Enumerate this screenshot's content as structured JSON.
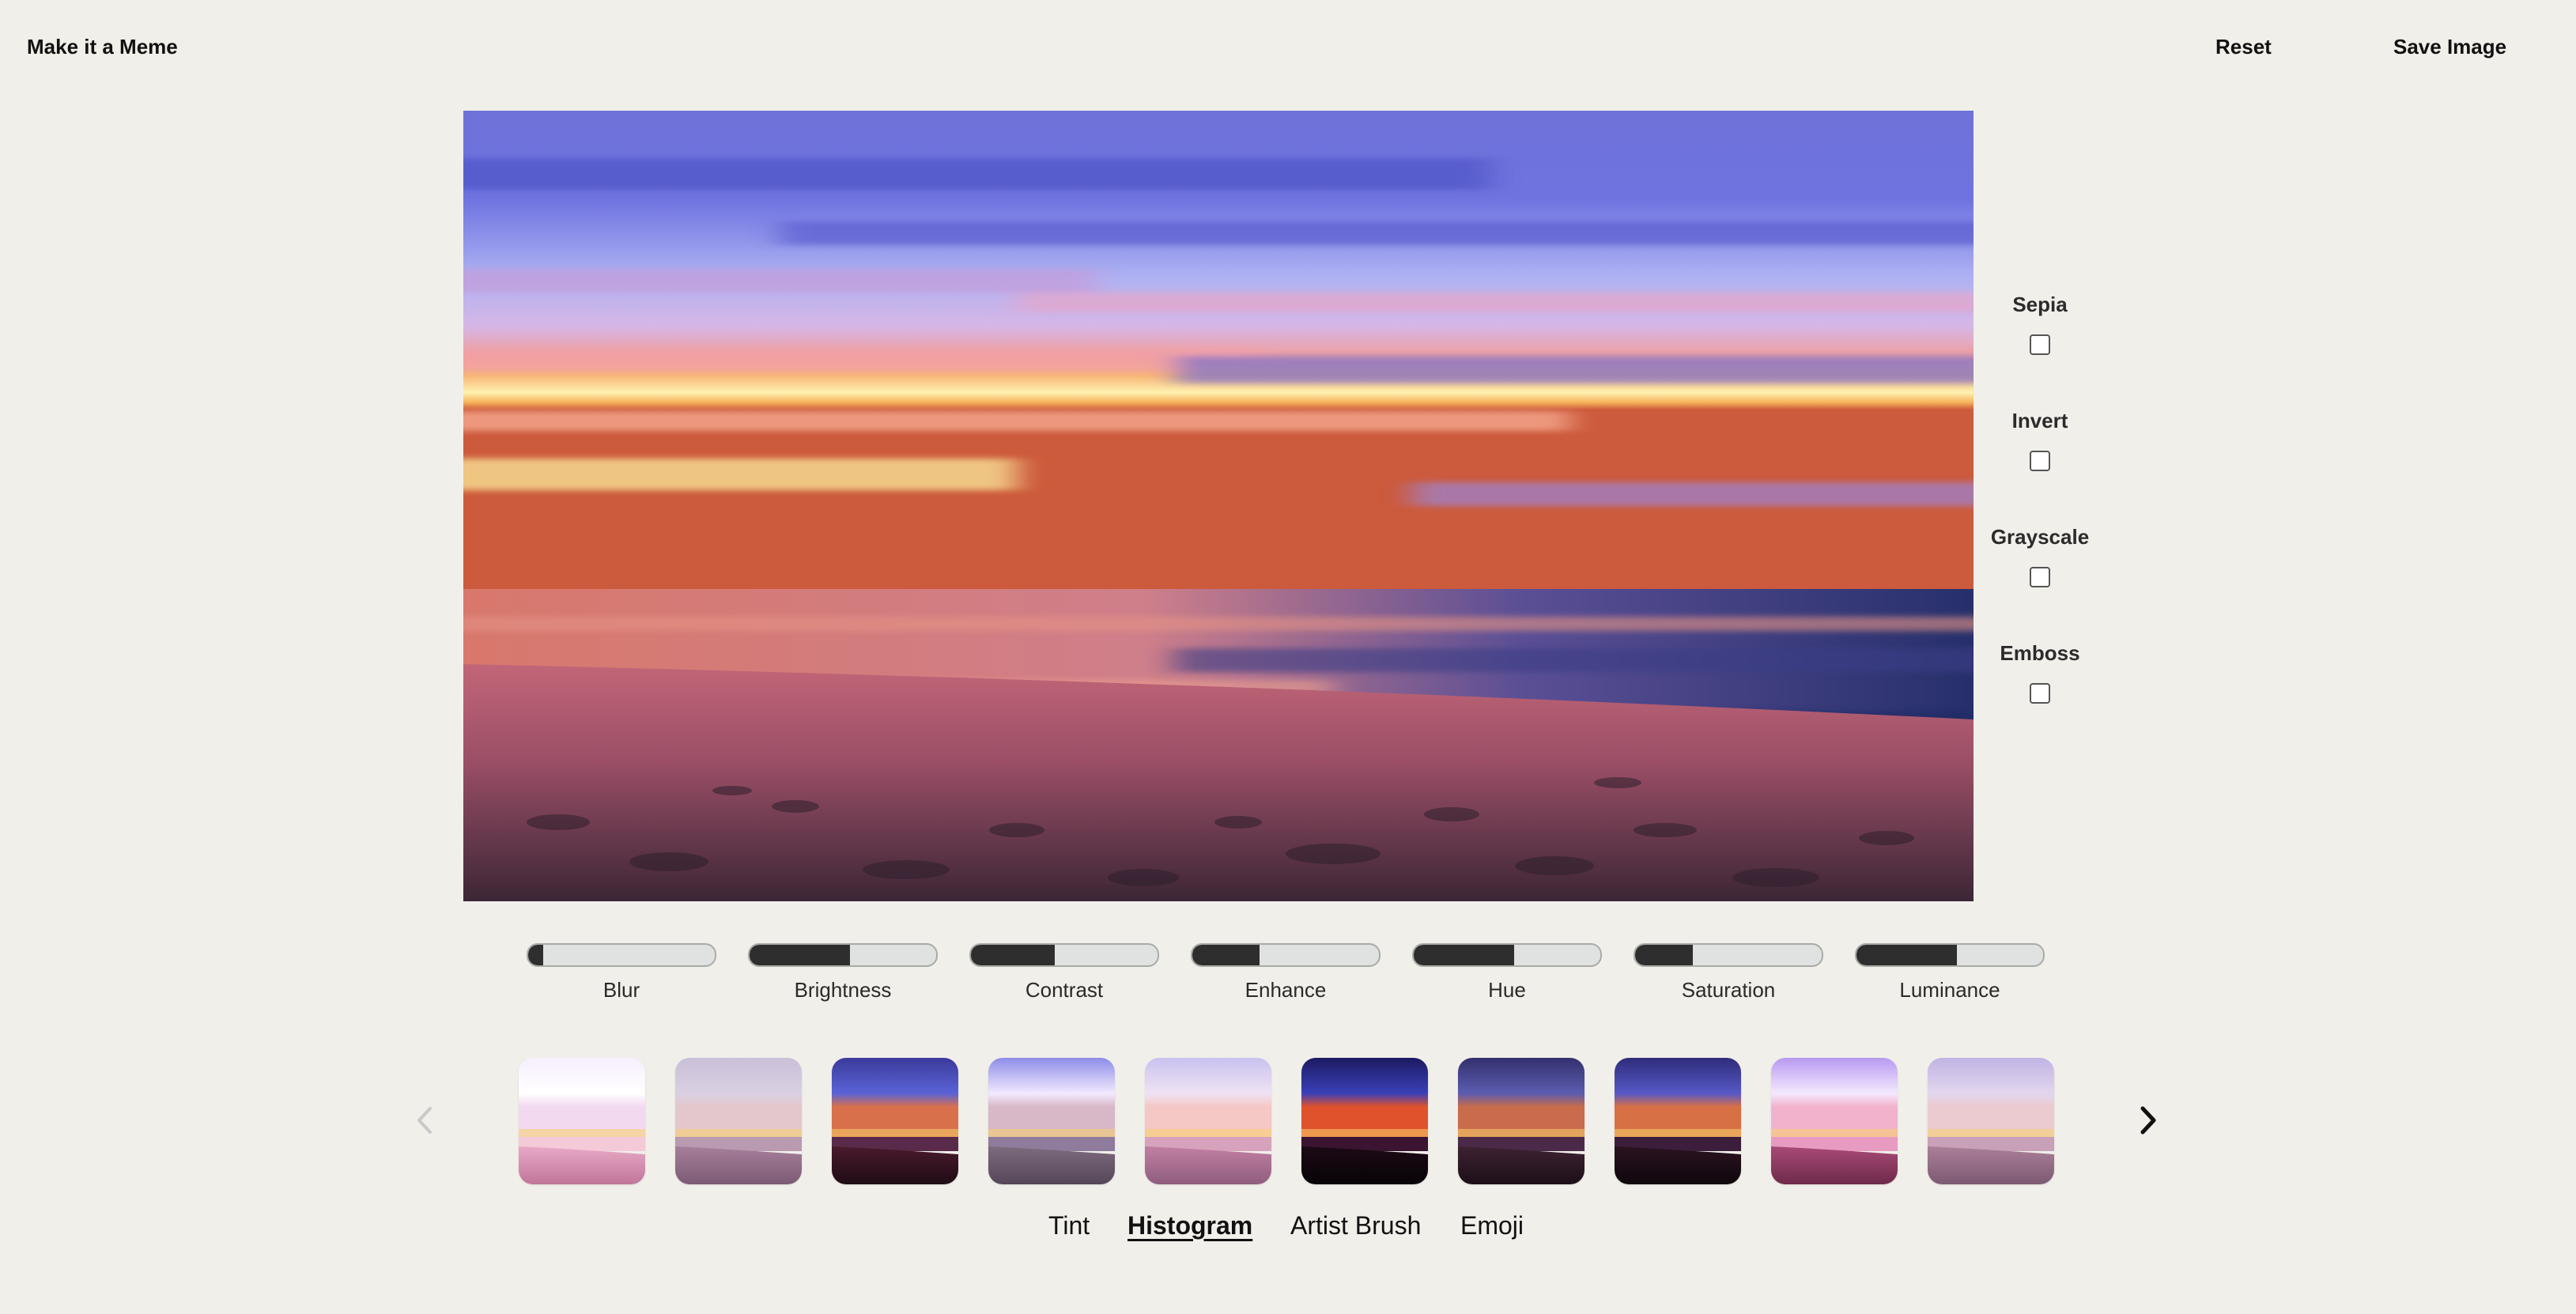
{
  "header": {
    "brand": "Make it a Meme",
    "reset_label": "Reset",
    "save_label": "Save Image"
  },
  "effects": [
    {
      "label": "Sepia",
      "checked": false
    },
    {
      "label": "Invert",
      "checked": false
    },
    {
      "label": "Grayscale",
      "checked": false
    },
    {
      "label": "Emboss",
      "checked": false
    }
  ],
  "sliders": [
    {
      "label": "Blur",
      "value": 0.08
    },
    {
      "label": "Brightness",
      "value": 0.54
    },
    {
      "label": "Contrast",
      "value": 0.45
    },
    {
      "label": "Enhance",
      "value": 0.36
    },
    {
      "label": "Hue",
      "value": 0.54
    },
    {
      "label": "Saturation",
      "value": 0.31
    },
    {
      "label": "Luminance",
      "value": 0.54
    }
  ],
  "carousel": {
    "prev_icon": "chevron-left-icon",
    "next_icon": "chevron-right-icon",
    "prev_disabled": true,
    "thumbnail_count": 10
  },
  "tabs": [
    {
      "label": "Tint",
      "active": false
    },
    {
      "label": "Histogram",
      "active": true
    },
    {
      "label": "Artist Brush",
      "active": false
    },
    {
      "label": "Emoji",
      "active": false
    }
  ],
  "colors": {
    "background": "#f1efea",
    "slider_fill": "#2e2e2e",
    "slider_track": "#dfe2e0"
  }
}
